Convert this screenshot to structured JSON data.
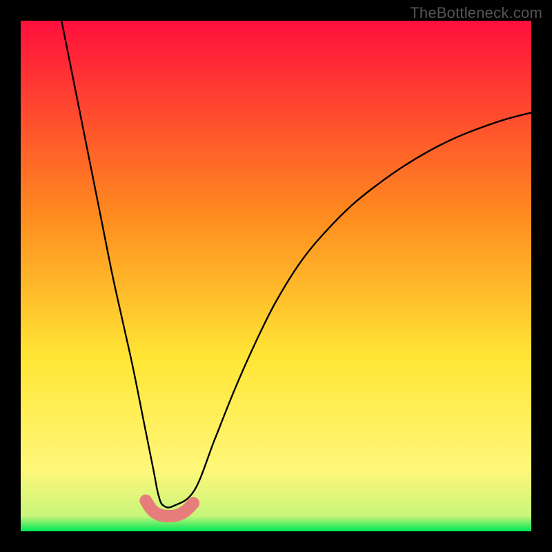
{
  "watermark": "TheBottleneck.com",
  "chart_data": {
    "type": "line",
    "title": "",
    "xlabel": "",
    "ylabel": "",
    "xlim": [
      0,
      100
    ],
    "ylim": [
      0,
      100
    ],
    "grid": false,
    "legend": false,
    "background_gradient": {
      "top_color": "#ff0f3c",
      "mid_colors": [
        "#ff8b1f",
        "#ffe635",
        "#fff77a"
      ],
      "bottom_color": "#00e756"
    },
    "series": [
      {
        "name": "bottleneck-curve",
        "type": "line",
        "color": "#000000",
        "x": [
          8,
          10,
          12,
          14,
          16,
          18,
          20,
          22,
          24,
          26,
          27,
          28,
          30,
          34,
          38,
          42,
          46,
          50,
          55,
          60,
          65,
          70,
          75,
          80,
          85,
          90,
          95,
          100
        ],
        "y": [
          100,
          90,
          80,
          70,
          60,
          50,
          41,
          32,
          22,
          12,
          7,
          5,
          5,
          8,
          18,
          28,
          37,
          45,
          53,
          59,
          64,
          68,
          71.5,
          74.5,
          77,
          79,
          80.7,
          82
        ]
      },
      {
        "name": "optimal-zone-markers",
        "type": "scatter",
        "color": "#e77d7a",
        "marker_size_px": 12,
        "x": [
          24.5,
          25.7,
          27.0,
          28.3,
          29.5,
          30.8,
          32.3,
          33.8
        ],
        "y": [
          6.0,
          4.2,
          3.3,
          3.0,
          3.0,
          3.2,
          4.0,
          5.5
        ]
      },
      {
        "name": "optimal-zone-band",
        "type": "line",
        "color": "#e77d7a",
        "stroke_width_px": 18,
        "x": [
          24.5,
          25.7,
          27.0,
          28.3,
          29.5,
          30.8,
          32.3,
          33.8
        ],
        "y": [
          6.0,
          4.2,
          3.3,
          3.0,
          3.0,
          3.2,
          4.0,
          5.5
        ]
      }
    ]
  }
}
